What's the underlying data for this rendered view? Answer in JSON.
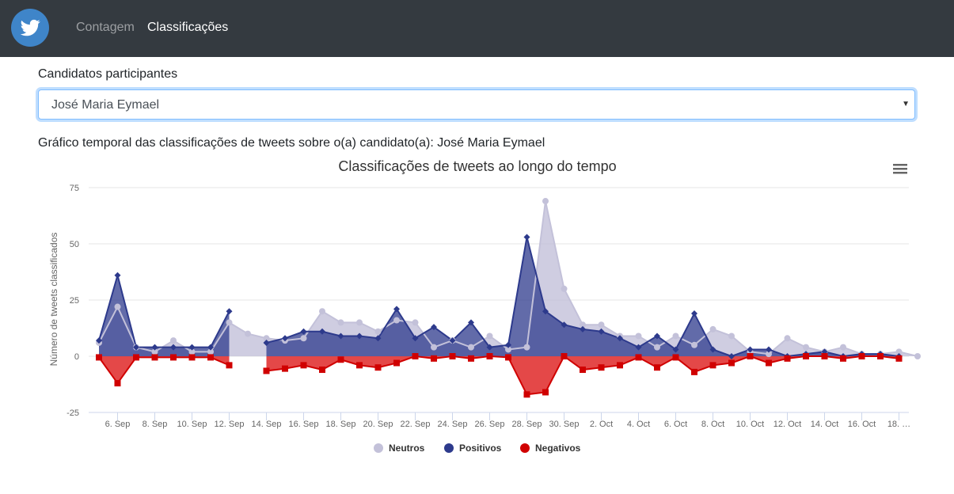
{
  "nav": {
    "links": [
      {
        "label": "Contagem",
        "active": false
      },
      {
        "label": "Classificações",
        "active": true
      }
    ]
  },
  "form": {
    "label": "Candidatos participantes",
    "selected": "José Maria Eymael"
  },
  "caption": "Gráfico temporal das classificações de tweets sobre o(a) candidato(a): José Maria Eymael",
  "chart_data": {
    "type": "area",
    "title": "Classificações de tweets ao longo do tempo",
    "ylabel": "Número de tweets classificados",
    "ylim": [
      -25,
      75
    ],
    "yticks": [
      -25,
      0,
      25,
      50,
      75
    ],
    "x_start": "2018-09-05",
    "x_tick_labels": [
      "6. Sep",
      "8. Sep",
      "10. Sep",
      "12. Sep",
      "14. Sep",
      "16. Sep",
      "18. Sep",
      "20. Sep",
      "22. Sep",
      "24. Sep",
      "26. Sep",
      "28. Sep",
      "30. Sep",
      "2. Oct",
      "4. Oct",
      "6. Oct",
      "8. Oct",
      "10. Oct",
      "12. Oct",
      "14. Oct",
      "16. Oct",
      "18. …"
    ],
    "grid": true,
    "legend_position": "bottom",
    "series": [
      {
        "name": "Neutros",
        "color": "#c3c1d9",
        "marker": "circle",
        "values": [
          6,
          22,
          4,
          2,
          7,
          2,
          2,
          15,
          10,
          8,
          7,
          8,
          20,
          15,
          15,
          11,
          16,
          15,
          4,
          7,
          4,
          9,
          3,
          4,
          69,
          30,
          14,
          14,
          9,
          9,
          4,
          9,
          5,
          12,
          9,
          2,
          1,
          8,
          4,
          2,
          4,
          1,
          1,
          2,
          0
        ]
      },
      {
        "name": "Positivos",
        "color": "#2d3a8c",
        "marker": "diamond",
        "values": [
          7,
          36,
          4,
          4,
          4,
          4,
          4,
          20,
          null,
          6,
          8,
          11,
          11,
          9,
          9,
          8,
          21,
          8,
          13,
          7,
          15,
          4,
          5,
          53,
          20,
          14,
          12,
          11,
          8,
          4,
          9,
          3,
          19,
          3,
          0,
          3,
          3,
          0,
          1,
          2,
          0,
          1,
          1,
          0
        ]
      },
      {
        "name": "Negativos",
        "color": "#d00000",
        "marker": "square",
        "values": [
          -0.5,
          -12,
          -0.5,
          -0.5,
          -0.5,
          -0.5,
          -0.5,
          -4,
          null,
          -6.5,
          -5.5,
          -4,
          -6,
          -1.5,
          -4,
          -5,
          -3,
          0,
          -1,
          0,
          -1,
          0,
          -0.5,
          -17,
          -16,
          0,
          -6,
          -5,
          -4,
          -0.5,
          -5,
          -0.5,
          -7,
          -4,
          -3,
          0,
          -3,
          -1,
          0,
          0,
          -1,
          0,
          0,
          -1
        ]
      }
    ]
  },
  "icons": {
    "brand": "twitter-bird-icon",
    "menu": "hamburger-menu-icon"
  }
}
